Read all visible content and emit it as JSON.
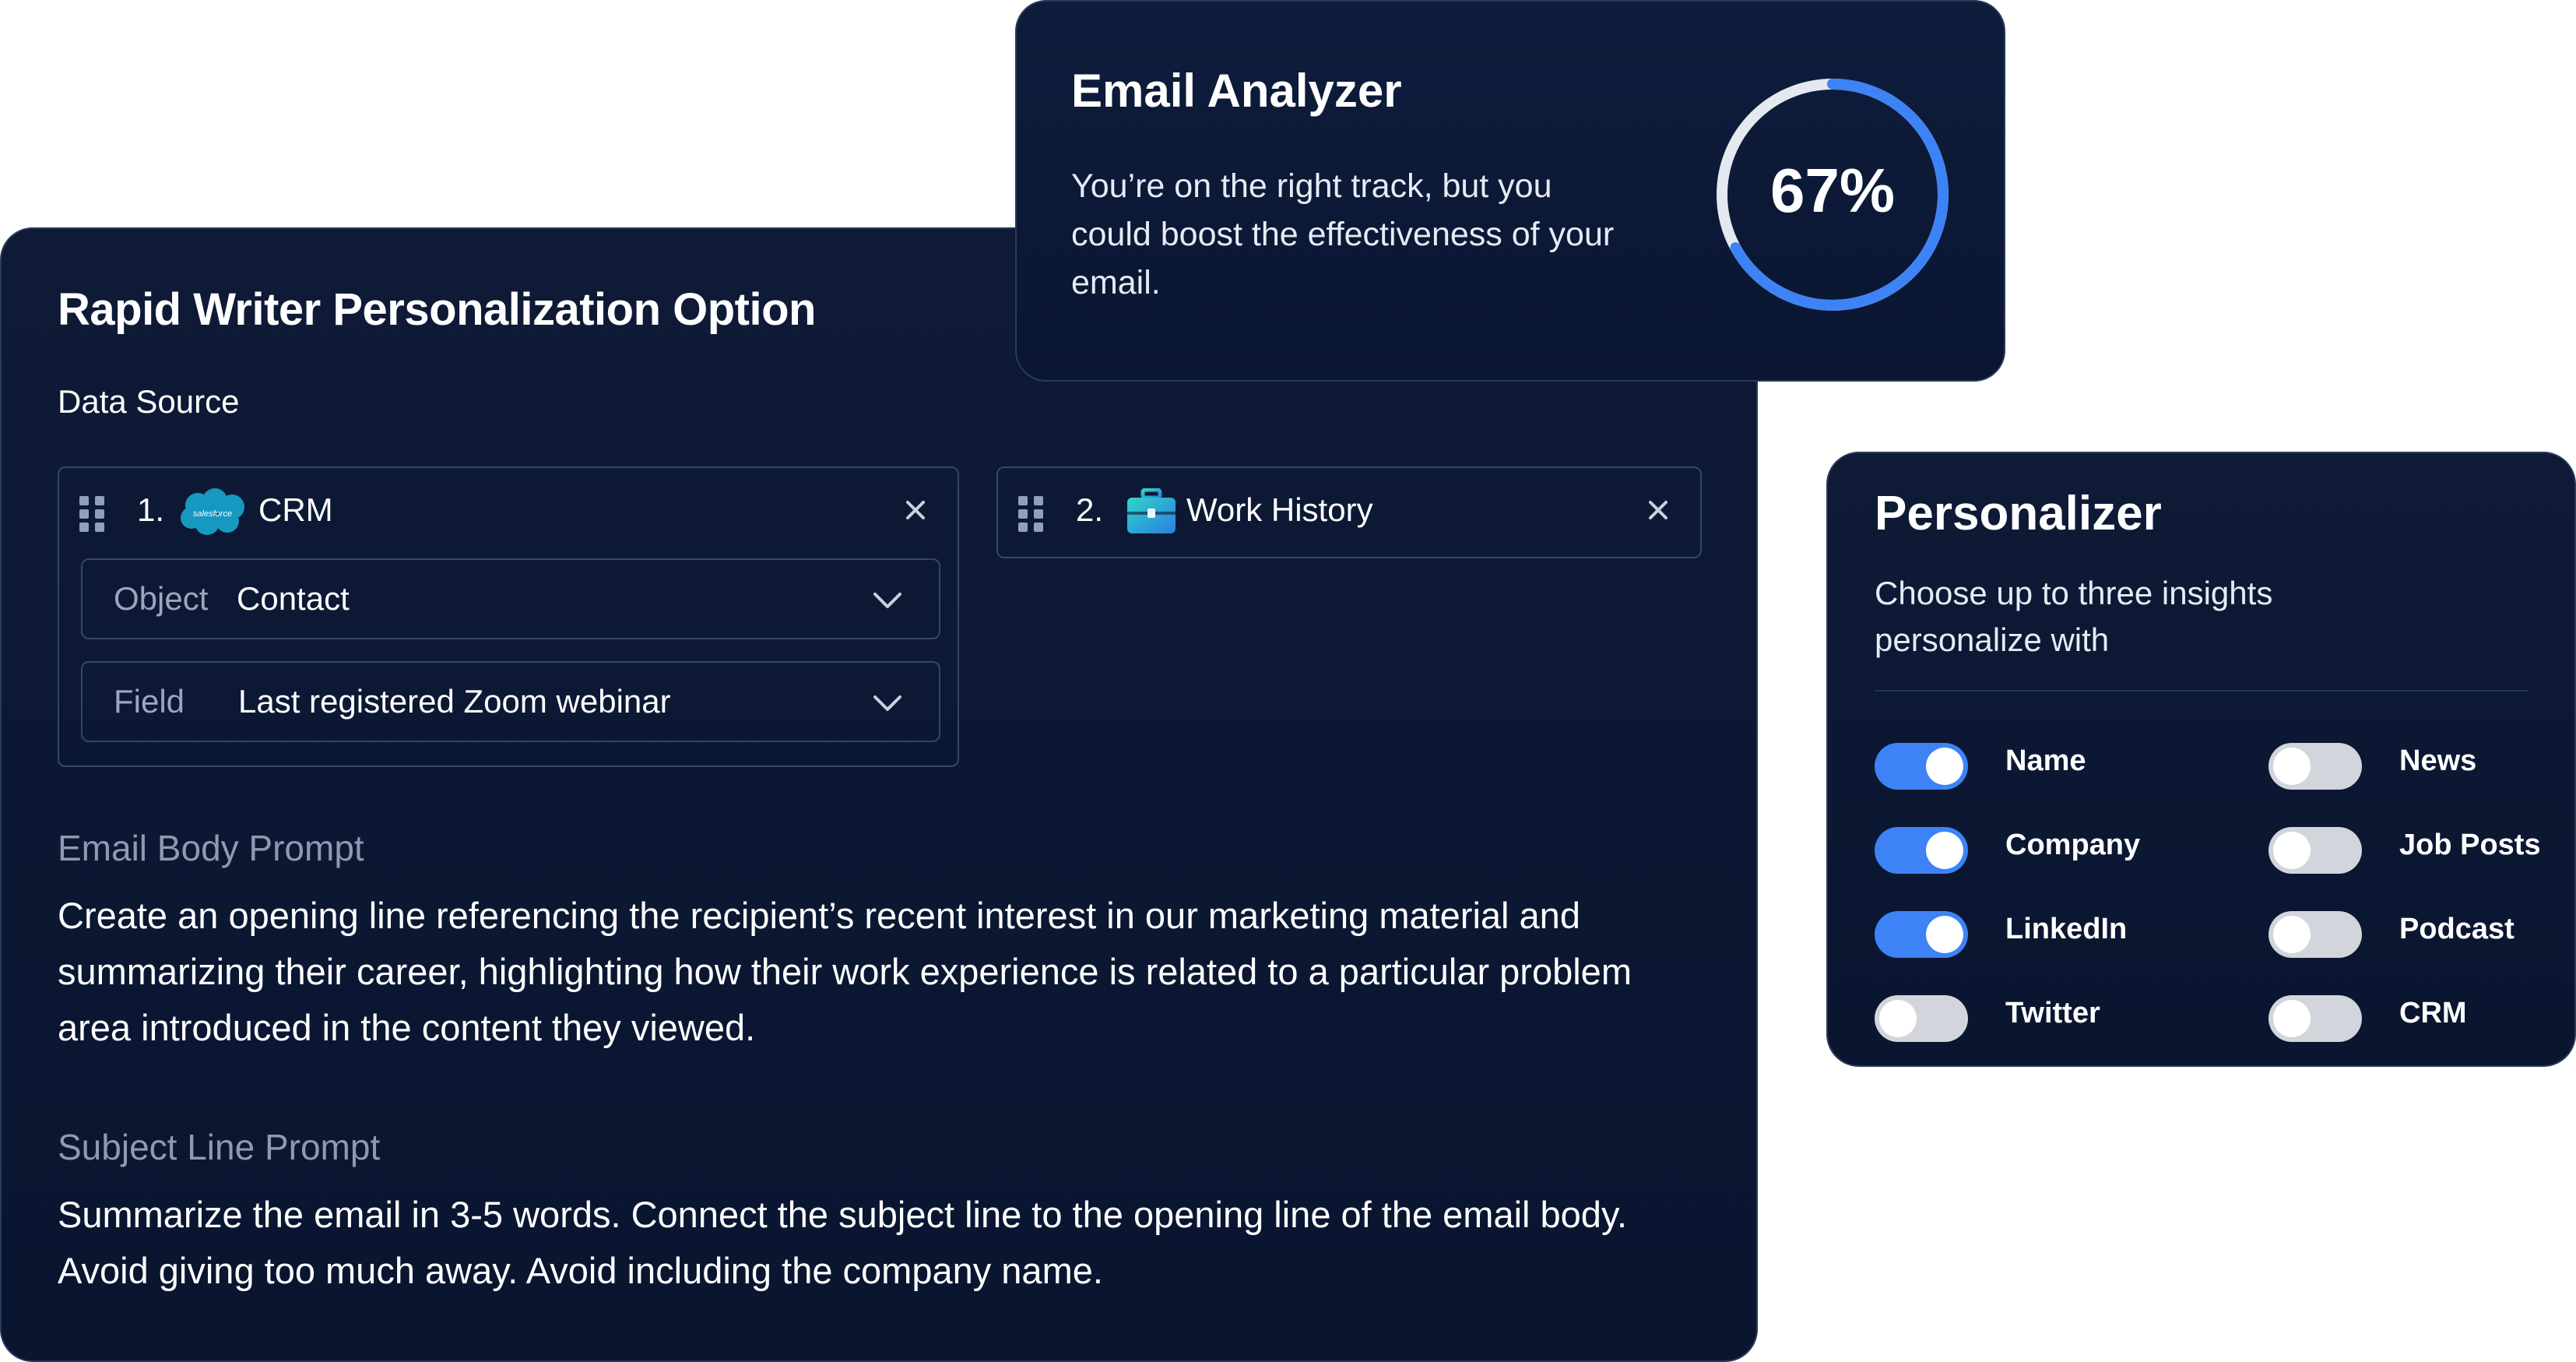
{
  "main": {
    "title": "Rapid Writer Personalization Option",
    "data_source_label": "Data Source",
    "sources": [
      {
        "number": "1.",
        "logo_text": "salesforce",
        "name": "CRM",
        "fields": [
          {
            "label": "Object",
            "value": "Contact"
          },
          {
            "label": "Field",
            "value": "Last registered Zoom webinar"
          }
        ]
      },
      {
        "number": "2.",
        "name": "Work History"
      }
    ],
    "email_body_label": "Email Body Prompt",
    "email_body_text": "Create an opening line referencing the recipient’s recent interest in our marketing material and summarizing their career, highlighting how their work experience is related to a particular problem area introduced in the content they viewed.",
    "subject_label": "Subject Line Prompt",
    "subject_text": "Summarize the email in 3-5 words. Connect the subject line to the opening line of the email body. Avoid giving too much away. Avoid including the company name."
  },
  "analyzer": {
    "title": "Email Analyzer",
    "message": "You’re on the right track, but you could boost the effectiveness of your email.",
    "score_text": "67%",
    "score_value": 0.67
  },
  "personalizer": {
    "title": "Personalizer",
    "subtitle": "Choose up to three insights personalize with",
    "toggles": [
      {
        "label": "Name",
        "on": true
      },
      {
        "label": "Company",
        "on": true
      },
      {
        "label": "LinkedIn",
        "on": true
      },
      {
        "label": "Twitter",
        "on": false
      },
      {
        "label": "News",
        "on": false
      },
      {
        "label": "Job Posts",
        "on": false
      },
      {
        "label": "Podcast",
        "on": false
      },
      {
        "label": "CRM",
        "on": false
      }
    ]
  },
  "colors": {
    "card_bg": "#0e1a36",
    "accent_blue": "#3d83f5",
    "toggle_off": "#d2d5db",
    "muted_text": "#8e9ab0",
    "salesforce_blue": "#1798c1"
  },
  "icons": [
    "drag-handle-icon",
    "salesforce-logo",
    "close-icon",
    "chevron-down-icon",
    "briefcase-icon"
  ]
}
